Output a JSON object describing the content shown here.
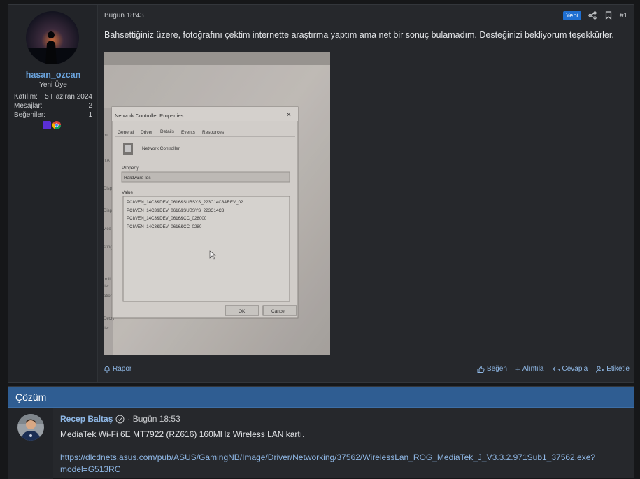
{
  "post": {
    "user": {
      "name": "hasan_ozcan",
      "title": "Yeni Üye",
      "stats": [
        {
          "label": "Katılım:",
          "value": "5 Haziran 2024"
        },
        {
          "label": "Mesajlar:",
          "value": "2"
        },
        {
          "label": "Beğeniler:",
          "value": "1"
        }
      ]
    },
    "date": "Bugün 18:43",
    "new_badge": "Yeni",
    "number": "#1",
    "text": "Bahsettiğiniz üzere, fotoğrafını çektim internette araştırma yaptım ama net bir sonuç bulamadım. Desteğinizi bekliyorum teşekkürler.",
    "photo": {
      "dialog_title": "Network Controller Properties",
      "tabs": [
        "General",
        "Driver",
        "Details",
        "Events",
        "Resources"
      ],
      "device": "Network Controller",
      "property_label": "Property",
      "property_value": "Hardware Ids",
      "value_label": "Value",
      "values": [
        "PCI\\VEN_14C3&DEV_0616&SUBSYS_223C14C3&REV_02",
        "PCI\\VEN_14C3&DEV_0616&SUBSYS_223C14C3",
        "PCI\\VEN_14C3&DEV_0616&CC_028000",
        "PCI\\VEN_14C3&DEV_0616&CC_0280"
      ],
      "ok": "OK",
      "cancel": "Cancel"
    },
    "footer": {
      "report": "Rapor",
      "like": "Beğen",
      "quote": "Alıntıla",
      "reply": "Cevapla",
      "tag": "Etiketle"
    }
  },
  "solution": {
    "header": "Çözüm",
    "author": "Recep Baltaş",
    "date": "· Bugün 18:53",
    "text": "MediaTek Wi-Fi 6E MT7922 (RZ616) 160MHz Wireless LAN kartı.",
    "link": "https://dlcdnets.asus.com/pub/ASUS/GamingNB/Image/Driver/Networking/37562/WirelessLan_ROG_MediaTek_J_V3.3.2.971Sub1_37562.exe?model=G513RC"
  },
  "colors": {
    "accent": "#1f6fd1",
    "link": "#8fb8e6",
    "username": "#6ba4de",
    "solution_header": "#2f5d92"
  }
}
